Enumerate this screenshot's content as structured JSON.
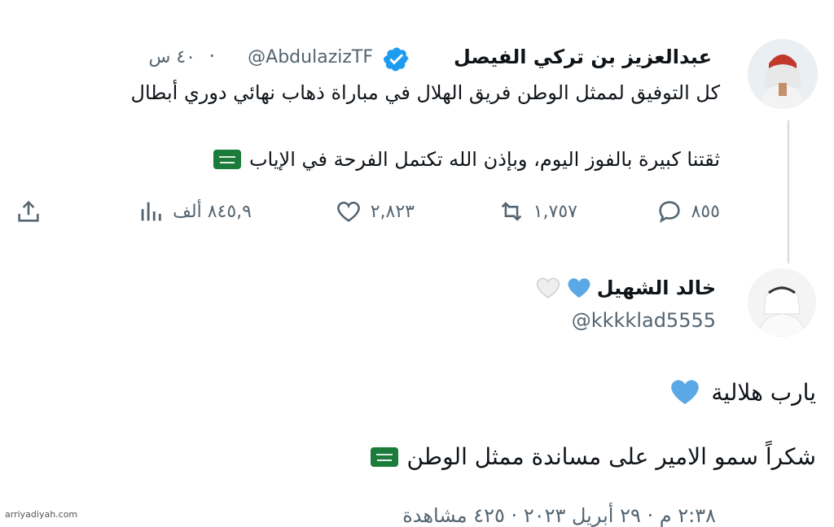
{
  "tweet": {
    "author_name": "عبدالعزيز بن تركي الفيصل",
    "handle": "@AbdulazizTF",
    "separator": "·",
    "time": "٤٠ س",
    "line1": "كل التوفيق لممثل الوطن فريق الهلال في مباراة ذهاب نهائي دوري أبطال",
    "line2": "ثقتنا كبيرة بالفوز اليوم، وبإذن الله تكتمل الفرحة في الإياب",
    "actions": {
      "replies": "٨٥٥",
      "retweets": "١,٧٥٧",
      "likes": "٢,٨٢٣",
      "views": "٨٤٥,٩ ألف"
    }
  },
  "reply": {
    "author_name": "خالد الشهيل",
    "handle": "@kkkklad5555",
    "line1": "يارب هلالية",
    "line2": "شكراً سمو الامير على مساندة ممثل الوطن",
    "footer": "٢:٣٨ م · ٢٩ أبريل ٢٠٢٣ · ٤٢٥ مشاهدة"
  },
  "colors": {
    "verified_blue": "#1d9bf0",
    "heart_blue": "#5aa9e6",
    "flag_green": "#1b7b3a",
    "muted_text": "#536471"
  },
  "watermark": "arriyadiyah.com"
}
